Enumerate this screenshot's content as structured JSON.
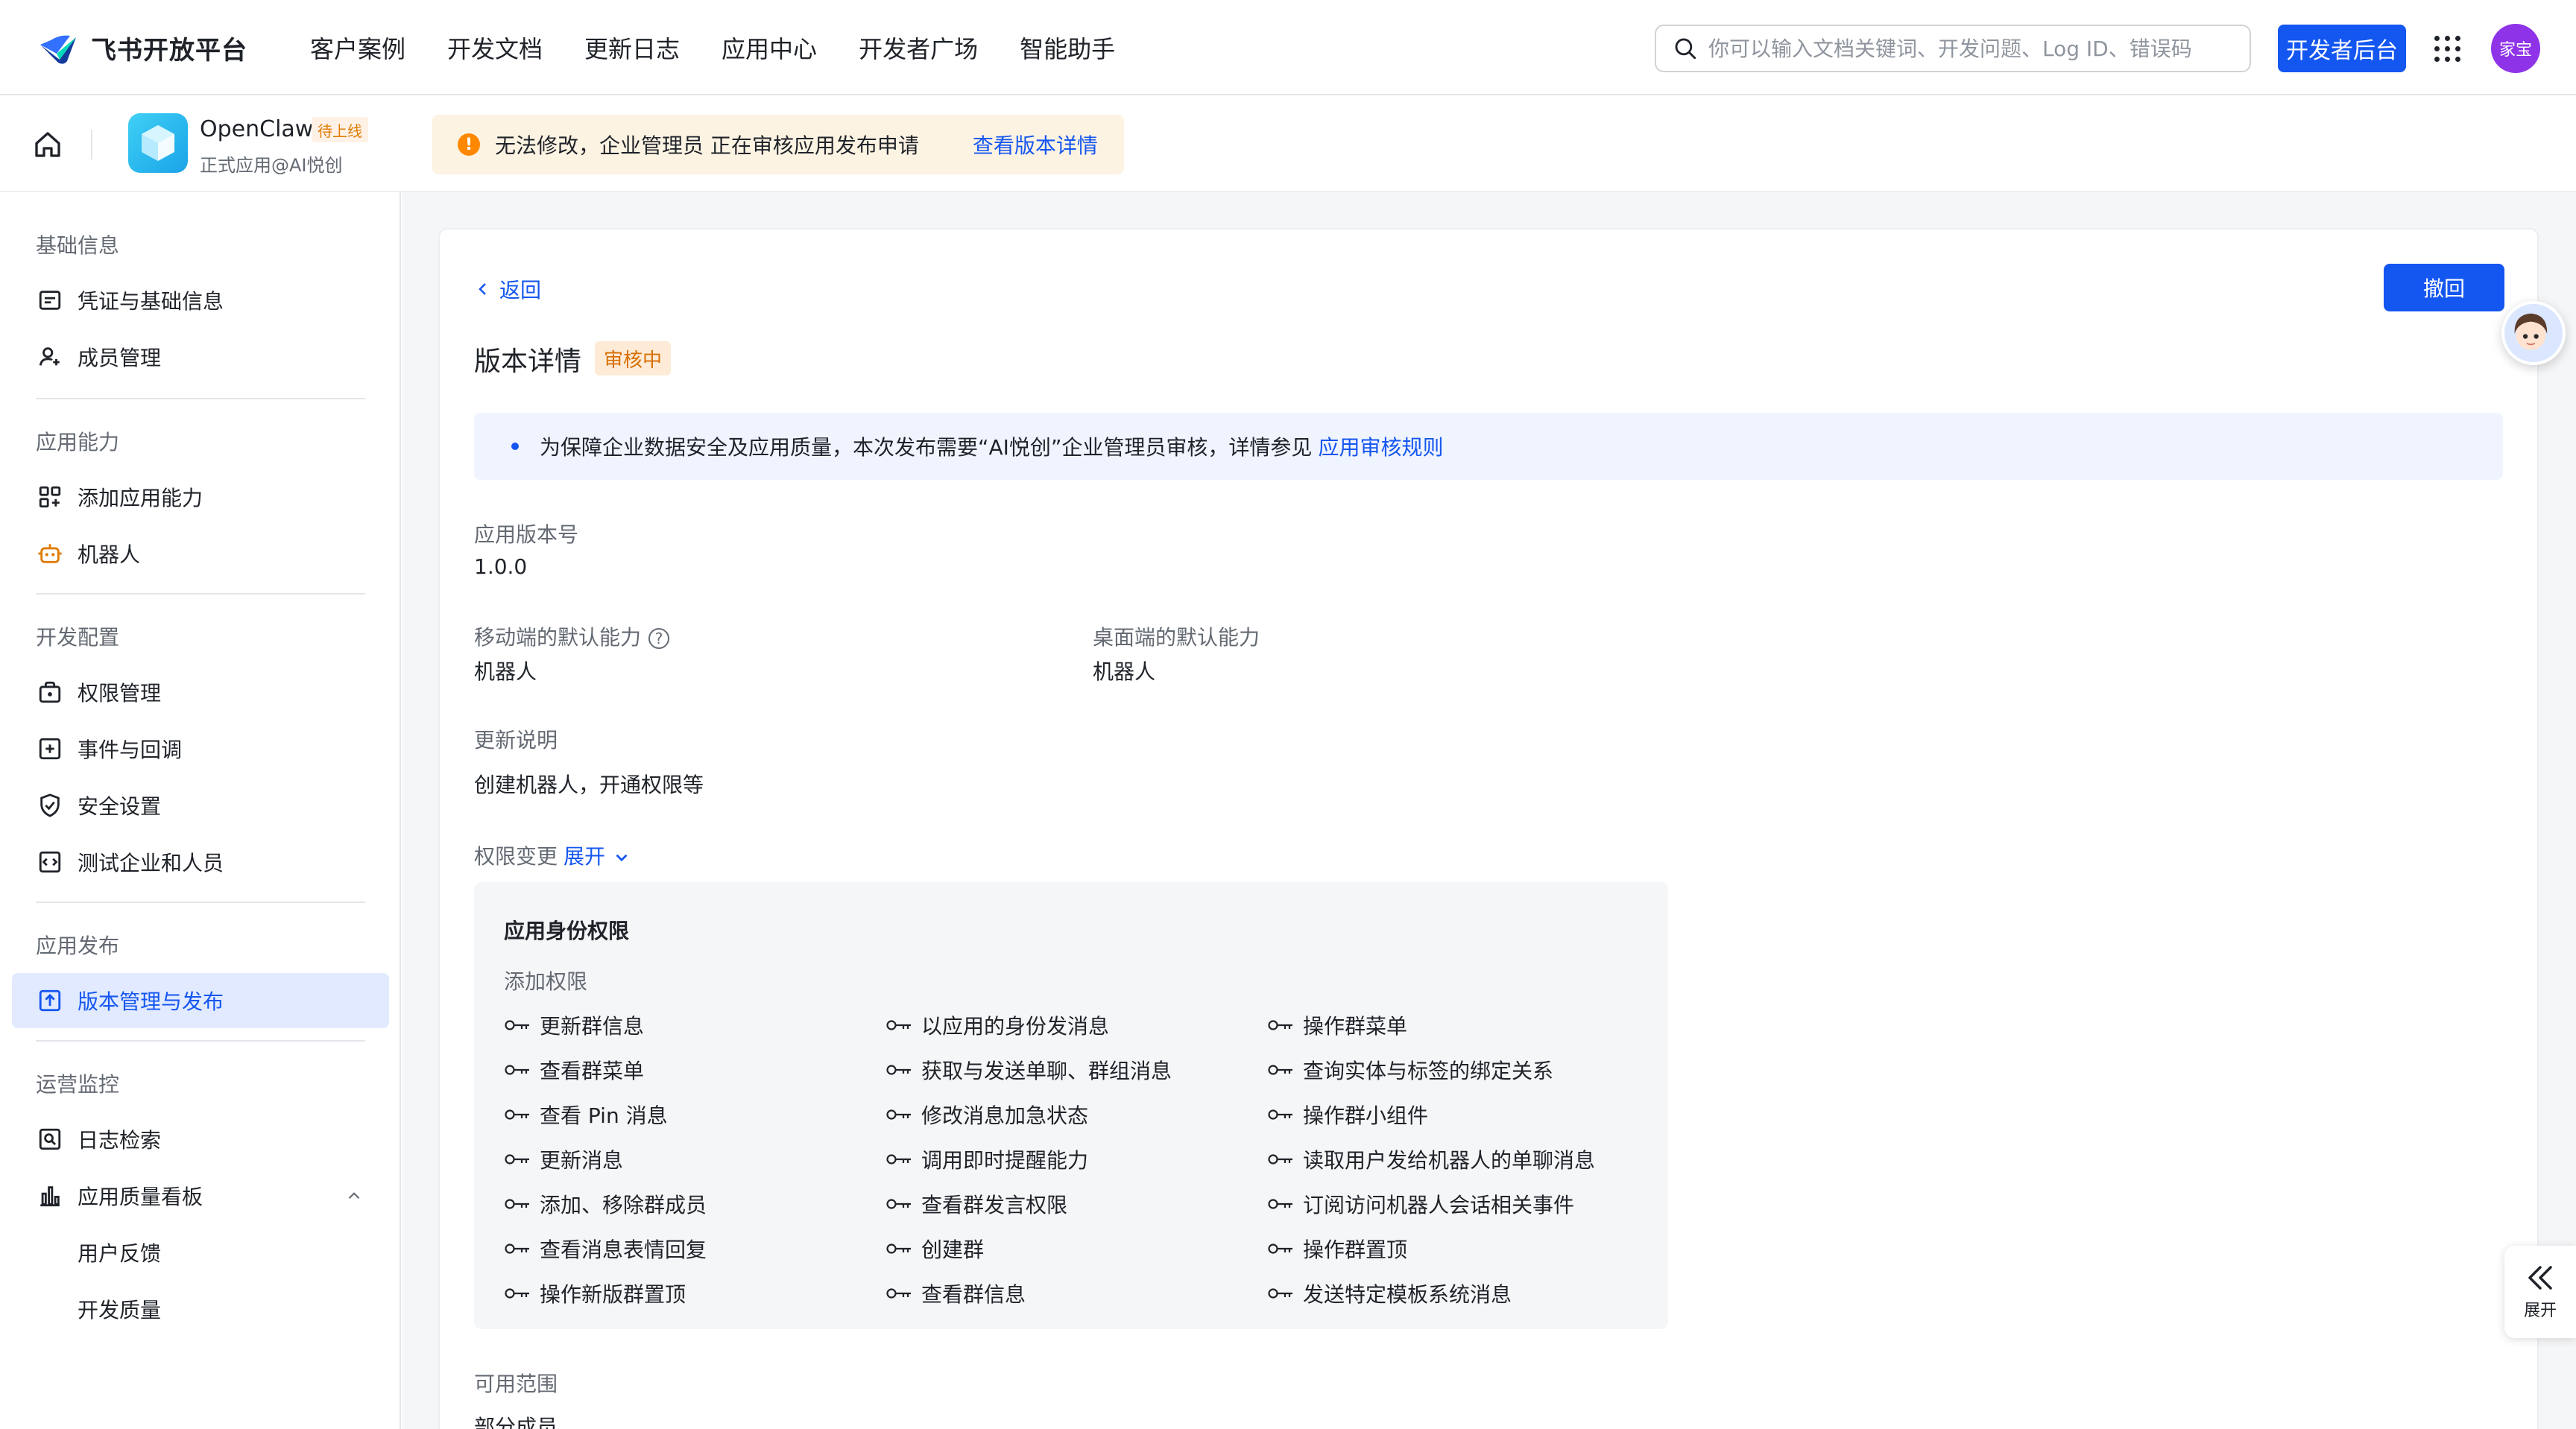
{
  "topnav": {
    "brand": "飞书开放平台",
    "items": [
      "客户案例",
      "开发文档",
      "更新日志",
      "应用中心",
      "开发者广场",
      "智能助手"
    ],
    "search_placeholder": "你可以输入文档关键词、开发问题、Log ID、错误码",
    "dev_console": "开发者后台",
    "avatar_text": "家宝"
  },
  "app": {
    "name": "OpenClaw",
    "status": "待上线",
    "subtitle": "正式应用@AI悦创",
    "warning": "无法修改，企业管理员 正在审核应用发布申请",
    "warning_link": "查看版本详情"
  },
  "sidebar": {
    "groups": [
      {
        "label": "基础信息",
        "items": [
          "凭证与基础信息",
          "成员管理"
        ]
      },
      {
        "label": "应用能力",
        "items": [
          "添加应用能力",
          "机器人"
        ]
      },
      {
        "label": "开发配置",
        "items": [
          "权限管理",
          "事件与回调",
          "安全设置",
          "测试企业和人员"
        ]
      },
      {
        "label": "应用发布",
        "items": [
          "版本管理与发布"
        ]
      },
      {
        "label": "运营监控",
        "items": [
          "日志检索",
          "应用质量看板",
          "用户反馈",
          "开发质量"
        ]
      }
    ],
    "active": "版本管理与发布"
  },
  "detail": {
    "back": "返回",
    "revoke": "撤回",
    "title": "版本详情",
    "badge": "审核中",
    "info_text": "为保障企业数据安全及应用质量，本次发布需要“AI悦创”企业管理员审核，详情参见",
    "info_link": "应用审核规则",
    "version_label": "应用版本号",
    "version_value": "1.0.0",
    "mobile_label": "移动端的默认能力",
    "mobile_value": "机器人",
    "desktop_label": "桌面端的默认能力",
    "desktop_value": "机器人",
    "notes_label": "更新说明",
    "notes_value": "创建机器人，开通权限等",
    "perm_change_label": "权限变更",
    "perm_change_expand": "展开",
    "scope_label": "可用范围",
    "scope_value": "部分成员"
  },
  "permissions": {
    "title": "应用身份权限",
    "subtitle": "添加权限",
    "columns": [
      [
        "更新群信息",
        "查看群菜单",
        "查看 Pin 消息",
        "更新消息",
        "添加、移除群成员",
        "查看消息表情回复",
        "操作新版群置顶"
      ],
      [
        "以应用的身份发消息",
        "获取与发送单聊、群组消息",
        "修改消息加急状态",
        "调用即时提醒能力",
        "查看群发言权限",
        "创建群",
        "查看群信息"
      ],
      [
        "操作群菜单",
        "查询实体与标签的绑定关系",
        "操作群小组件",
        "读取用户发给机器人的单聊消息",
        "订阅访问机器人会话相关事件",
        "操作群置顶",
        "发送特定模板系统消息"
      ]
    ]
  },
  "floating": {
    "expand_label": "展开"
  },
  "colors": {
    "primary": "#1456f0",
    "warning": "#ff8800",
    "active_bg": "#e1eaff",
    "page_bg": "#f5f6f7"
  }
}
